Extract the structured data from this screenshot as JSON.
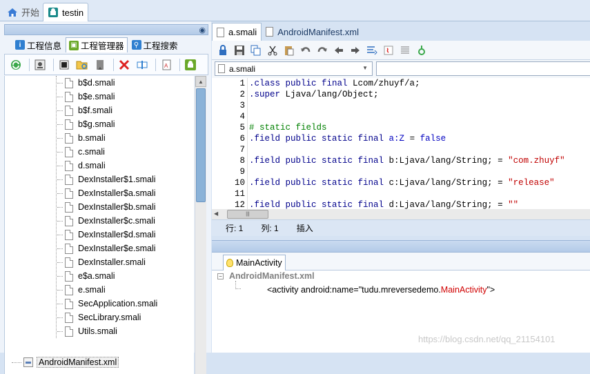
{
  "top_tabs": [
    {
      "label": "开始",
      "icon": "home-icon"
    },
    {
      "label": "testin",
      "icon": "android-icon"
    }
  ],
  "left_tabs": [
    {
      "label": "工程信息",
      "icon": "info-icon",
      "color": "#2f7fd0"
    },
    {
      "label": "工程管理器",
      "icon": "android-icon",
      "color": "#6aa829"
    },
    {
      "label": "工程搜索",
      "icon": "search-icon",
      "color": "#2f7fd0"
    }
  ],
  "tree": {
    "files": [
      "b$d.smali",
      "b$e.smali",
      "b$f.smali",
      "b$g.smali",
      "b.smali",
      "c.smali",
      "d.smali",
      "DexInstaller$1.smali",
      "DexInstaller$a.smali",
      "DexInstaller$b.smali",
      "DexInstaller$c.smali",
      "DexInstaller$d.smali",
      "DexInstaller$e.smali",
      "DexInstaller.smali",
      "e$a.smali",
      "e.smali",
      "SecApplication.smali",
      "SecLibrary.smali",
      "Utils.smali"
    ],
    "manifest": "AndroidManifest.xml"
  },
  "editor_tabs": [
    {
      "label": "a.smali"
    },
    {
      "label": "AndroidManifest.xml"
    }
  ],
  "class_combo": {
    "value": "a.smali"
  },
  "code_lines": [
    {
      "n": "1",
      "parts": [
        {
          "t": ".class public final ",
          "c": "kw"
        },
        {
          "t": "Lcom/zhuyf/a;",
          "c": ""
        }
      ]
    },
    {
      "n": "2",
      "parts": [
        {
          "t": ".super ",
          "c": "kw"
        },
        {
          "t": "Ljava/lang/Object;",
          "c": ""
        }
      ]
    },
    {
      "n": "3",
      "parts": []
    },
    {
      "n": "4",
      "parts": []
    },
    {
      "n": "5",
      "parts": [
        {
          "t": "# static fields",
          "c": "cm"
        }
      ]
    },
    {
      "n": "6",
      "parts": [
        {
          "t": ".field public static final ",
          "c": "kw"
        },
        {
          "t": "a:Z",
          "c": "bool"
        },
        {
          "t": " = ",
          "c": ""
        },
        {
          "t": "false",
          "c": "bool"
        }
      ]
    },
    {
      "n": "7",
      "parts": []
    },
    {
      "n": "8",
      "parts": [
        {
          "t": ".field public static final ",
          "c": "kw"
        },
        {
          "t": "b:Ljava/lang/String; = ",
          "c": ""
        },
        {
          "t": "\"com.zhuyf\"",
          "c": "str"
        }
      ]
    },
    {
      "n": "9",
      "parts": []
    },
    {
      "n": "10",
      "parts": [
        {
          "t": ".field public static final ",
          "c": "kw"
        },
        {
          "t": "c:Ljava/lang/String; = ",
          "c": ""
        },
        {
          "t": "\"release\"",
          "c": "str"
        }
      ]
    },
    {
      "n": "11",
      "parts": []
    },
    {
      "n": "12",
      "parts": [
        {
          "t": ".field public static final ",
          "c": "kw"
        },
        {
          "t": "d:Ljava/lang/String; = ",
          "c": ""
        },
        {
          "t": "\"\"",
          "c": "str"
        }
      ]
    }
  ],
  "status": {
    "row": "行: 1",
    "col": "列: 1",
    "mode": "插入"
  },
  "lower_tab": {
    "label": "MainActivity"
  },
  "xml_tree": {
    "root": "AndroidManifest.xml",
    "child_prefix": "<activity android:name=\"tudu.mreversedemo.",
    "child_highlight": "MainActivity",
    "child_suffix": "\">"
  },
  "watermark": "https://blog.csdn.net/qq_21154101"
}
